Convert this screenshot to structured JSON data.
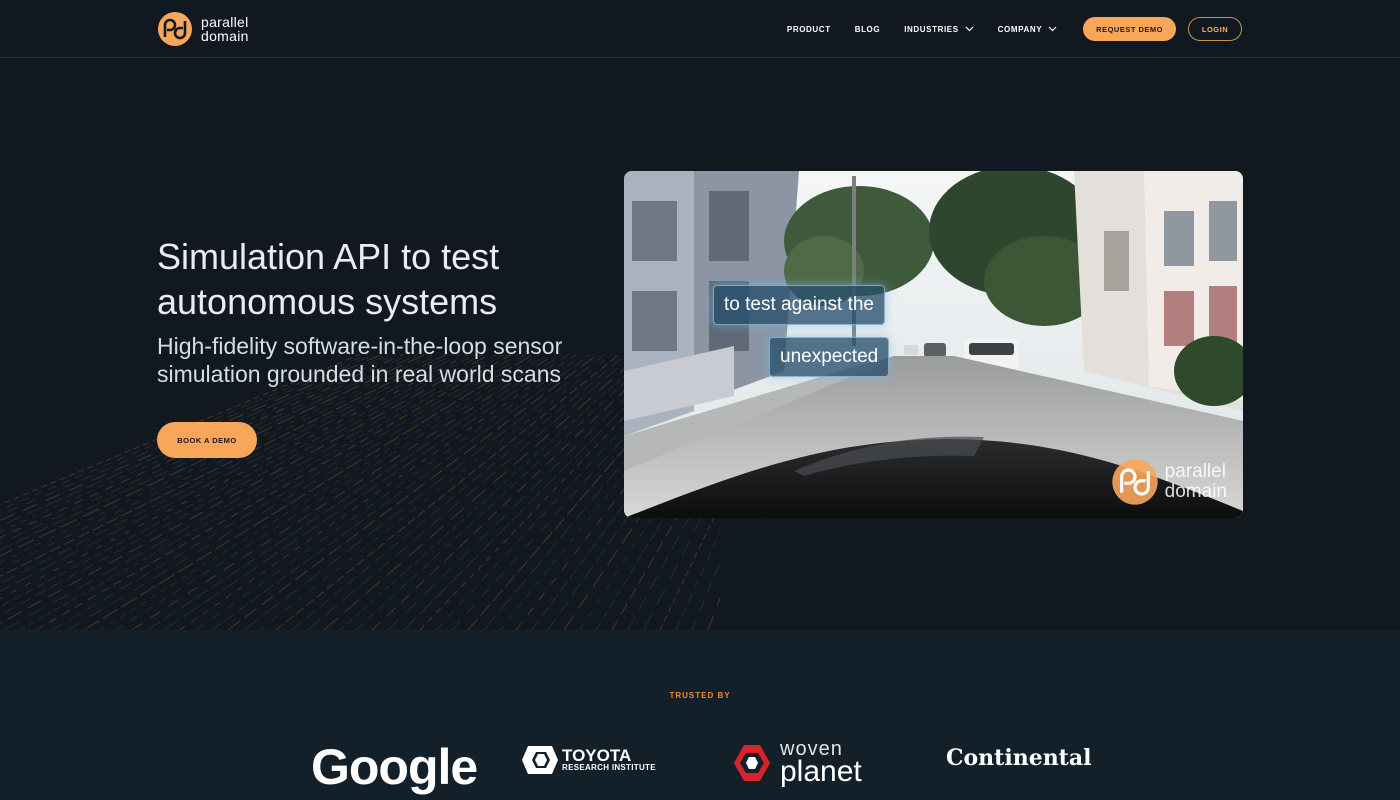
{
  "header": {
    "logo_line1": "parallel",
    "logo_line2": "domain",
    "nav": [
      {
        "label": "PRODUCT"
      },
      {
        "label": "BLOG"
      },
      {
        "label": "INDUSTRIES"
      },
      {
        "label": "COMPANY"
      }
    ],
    "request_demo": "REQUEST DEMO",
    "login": "LOGIN"
  },
  "hero": {
    "title": "Simulation API to test autonomous systems",
    "subtitle": "High-fidelity software-in-the-loop sensor simulation grounded in real world scans",
    "cta": "BOOK A DEMO",
    "video": {
      "caption_line1": "to test against the",
      "caption_line2": "unexpected",
      "watermark_line1": "parallel",
      "watermark_line2": "domain"
    }
  },
  "trusted": {
    "label": "TRUSTED BY",
    "logos": {
      "google": "Google",
      "toyota_line1": "TOYOTA",
      "toyota_line2": "RESEARCH INSTITUTE",
      "woven_line1": "woven",
      "woven_line2": "planet",
      "continental": "Continental"
    }
  },
  "colors": {
    "background": "#111820",
    "accent": "#f8a65a",
    "trusted_label": "#f0892c",
    "trusted_bg": "#142029"
  }
}
